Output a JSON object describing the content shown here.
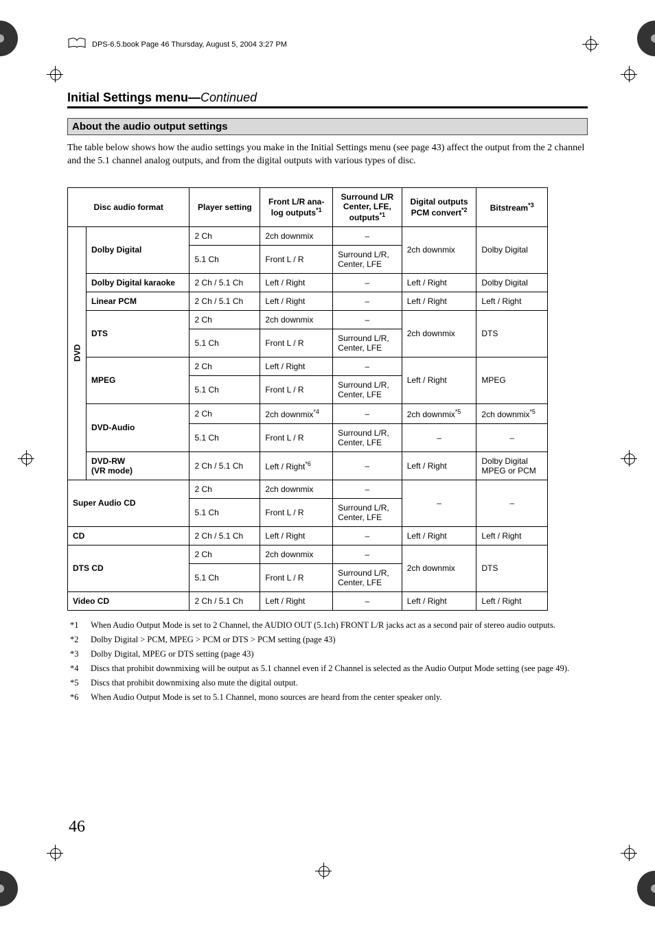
{
  "header": {
    "book_line": "DPS-6.5.book  Page 46  Thursday, August 5, 2004  3:27 PM"
  },
  "section": {
    "title_main": "Initial Settings menu",
    "title_sep": "—",
    "title_cont": "Continued"
  },
  "subhead": "About the audio output settings",
  "intro": "The table below shows how the audio settings you make in the Initial Settings menu (see page 43) affect the output from the 2 channel and the 5.1 channel analog outputs, and from the digital outputs with various types of disc.",
  "table": {
    "head": {
      "disc_audio_format": "Disc audio format",
      "player_setting": "Player setting",
      "front_lr": "Front L/R ana-\nlog outputs",
      "front_lr_sup": "*1",
      "surround": "Surround L/R\nCenter, LFE,\noutputs",
      "surround_sup": "*1",
      "digital_pcm": "Digital outputs\nPCM convert",
      "digital_pcm_sup": "*2",
      "bitstream": "Bitstream",
      "bitstream_sup": "*3"
    },
    "dvd_label": "DVD",
    "rows": {
      "dolby_digital": {
        "label": "Dolby Digital",
        "r1": {
          "ps": "2 Ch",
          "front": "2ch downmix",
          "surr": "–"
        },
        "r2": {
          "ps": "5.1 Ch",
          "front": "Front L / R",
          "surr": "Surround L/R,\nCenter, LFE"
        },
        "pcm": "2ch downmix",
        "bit": "Dolby Digital"
      },
      "dolby_karaoke": {
        "label": "Dolby Digital karaoke",
        "ps": "2 Ch / 5.1 Ch",
        "front": "Left / Right",
        "surr": "–",
        "pcm": "Left / Right",
        "bit": "Dolby Digital"
      },
      "linear_pcm": {
        "label": "Linear PCM",
        "ps": "2 Ch / 5.1 Ch",
        "front": "Left / Right",
        "surr": "–",
        "pcm": "Left / Right",
        "bit": "Left / Right"
      },
      "dts": {
        "label": "DTS",
        "r1": {
          "ps": "2 Ch",
          "front": "2ch downmix",
          "surr": "–"
        },
        "r2": {
          "ps": "5.1 Ch",
          "front": "Front L / R",
          "surr": "Surround L/R,\nCenter, LFE"
        },
        "pcm": "2ch downmix",
        "bit": "DTS"
      },
      "mpeg": {
        "label": "MPEG",
        "r1": {
          "ps": "2 Ch",
          "front": "Left / Right",
          "surr": "–"
        },
        "r2": {
          "ps": "5.1 Ch",
          "front": "Front L / R",
          "surr": "Surround L/R,\nCenter, LFE"
        },
        "pcm": "Left / Right",
        "bit": "MPEG"
      },
      "dvd_audio": {
        "label": "DVD-Audio",
        "r1": {
          "ps": "2 Ch",
          "front": "2ch downmix",
          "front_sup": "*4",
          "surr": "–",
          "pcm": "2ch downmix",
          "pcm_sup": "*5",
          "bit": "2ch downmix",
          "bit_sup": "*5"
        },
        "r2": {
          "ps": "5.1 Ch",
          "front": "Front L / R",
          "surr": "Surround L/R,\nCenter, LFE",
          "pcm": "–",
          "bit": "–"
        }
      },
      "dvd_rw": {
        "label": "DVD-RW\n(VR mode)",
        "ps": "2 Ch / 5.1 Ch",
        "front": "Left / Right",
        "front_sup": "*6",
        "surr": "–",
        "pcm": "Left / Right",
        "bit": "Dolby Digital\nMPEG or PCM"
      },
      "sacd": {
        "label": "Super Audio CD",
        "r1": {
          "ps": "2 Ch",
          "front": "2ch downmix",
          "surr": "–"
        },
        "r2": {
          "ps": "5.1 Ch",
          "front": "Front L / R",
          "surr": "Surround L/R,\nCenter, LFE"
        },
        "pcm": "–",
        "bit": "–"
      },
      "cd": {
        "label": "CD",
        "ps": "2 Ch / 5.1 Ch",
        "front": "Left / Right",
        "surr": "–",
        "pcm": "Left / Right",
        "bit": "Left / Right"
      },
      "dts_cd": {
        "label": "DTS CD",
        "r1": {
          "ps": "2 Ch",
          "front": "2ch downmix",
          "surr": "–"
        },
        "r2": {
          "ps": "5.1 Ch",
          "front": "Front L / R",
          "surr": "Surround L/R,\nCenter, LFE"
        },
        "pcm": "2ch downmix",
        "bit": "DTS"
      },
      "video_cd": {
        "label": "Video CD",
        "ps": "2 Ch / 5.1 Ch",
        "front": "Left / Right",
        "surr": "–",
        "pcm": "Left / Right",
        "bit": "Left / Right"
      }
    }
  },
  "footnotes": {
    "f1": {
      "num": "*1",
      "text": "When Audio Output Mode is set to 2 Channel, the AUDIO OUT (5.1ch) FRONT L/R jacks act as a second pair of stereo audio outputs."
    },
    "f2": {
      "num": "*2",
      "text": "Dolby Digital > PCM, MPEG > PCM or DTS > PCM setting (page 43)"
    },
    "f3": {
      "num": "*3",
      "text": "Dolby Digital, MPEG or DTS setting (page 43)"
    },
    "f4": {
      "num": "*4",
      "text": "Discs that prohibit downmixing will be output as 5.1 channel even if 2 Channel is selected as the Audio Output Mode setting (see page 49)."
    },
    "f5": {
      "num": "*5",
      "text": "Discs that prohibit downmixing also mute the digital output."
    },
    "f6": {
      "num": "*6",
      "text": "When Audio Output Mode is set to 5.1 Channel, mono sources are heard from the center speaker only."
    }
  },
  "page_number": "46"
}
